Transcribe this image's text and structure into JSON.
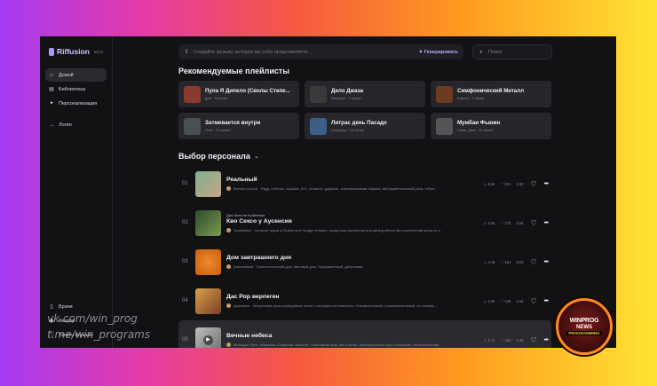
{
  "brand": {
    "name": "Riffusion",
    "beta": "BETA",
    "color": "#a896ff"
  },
  "sidebar": {
    "items": [
      {
        "label": "Домой",
        "icon": "home-icon",
        "active": true
      },
      {
        "label": "Библиотека",
        "icon": "library-icon"
      },
      {
        "label": "Персонализация",
        "icon": "personalize-icon"
      },
      {
        "label": "Логин",
        "icon": "login-icon"
      }
    ],
    "bottom": [
      {
        "label": "Врачи",
        "icon": "doc-icon"
      },
      {
        "label": "Раздор",
        "icon": "discord-icon"
      },
      {
        "label": "Узнать больше",
        "icon": "info-icon"
      }
    ]
  },
  "topbar": {
    "prompt_placeholder": "Создайте музыку, которую вы себе представляете...",
    "generate_label": "Генерировать",
    "search_placeholder": "Поиск"
  },
  "playlists_section": {
    "title": "Рекомендуемые плейлисты",
    "items": [
      {
        "title": "Пупа Я Дипело (Сволы Степе...",
        "meta": "дом · 9 песен",
        "color": "#8a3a2e"
      },
      {
        "title": "Дело Джаза",
        "meta": "Maverick · 7 песен",
        "color": "#3a3a3a"
      },
      {
        "title": "Симфонический Металл",
        "meta": "Katona · 7 песен",
        "color": "#6b3b22"
      },
      {
        "title": "Затмевается внутри",
        "meta": "Orbit · 10 песен",
        "color": "#4a4f55"
      },
      {
        "title": "Литрас день Пасадо",
        "meta": "Ceramica · 10 песен",
        "color": "#3b5f86"
      },
      {
        "title": "Мумбаи Фьюжн",
        "meta": "Cyber_bam · 11 песен",
        "color": "#555555"
      }
    ]
  },
  "picks_section": {
    "title": "Выбор персонала",
    "tracks": [
      {
        "num": "01",
        "label": "",
        "title": "Реальный",
        "desc": "Фонтан голоса · Рэдд, хтбилос, поршни, ATL, Атланта, ударные, альтернативная поршни, инструментальный ритм, хтбил...",
        "plays": "9.8к",
        "likes": "221",
        "duration": "2:40",
        "cover": "#6f8a7a"
      },
      {
        "num": "02",
        "label": "Que Sexo en la America",
        "title": "Кво Сексо у Аусенсия",
        "desc": "Транеёжно · Immerse signal of Dublin and Yongjin remarks, using basic waveforms and adding effects like experimental decay to s...",
        "plays": "3.9к",
        "likes": "175",
        "duration": "3:25",
        "cover": "#3f5f3a"
      },
      {
        "num": "03",
        "label": "",
        "title": "Дом завтрашнего дня",
        "desc": "Алексейвиа · Технологический дом, Миговый дом, Неукрашенный, дихотомии",
        "plays": "4.3к",
        "likes": "161",
        "duration": "2:53",
        "cover": "#d9781e"
      },
      {
        "num": "04",
        "label": "",
        "title": "Дас Рор верпеген",
        "desc": "Дорокиин · Энергичная фолк-комедийная песня с игрищем сентиментал, Оптимистичный и развлекательный, по словам,...",
        "plays": "3.9к",
        "likes": "129",
        "duration": "2:44",
        "cover": "#b87a3a"
      },
      {
        "num": "05",
        "label": "",
        "title": "Вечные небеса",
        "desc": "Молодая Петя · Мировая, Странная, эмбиент, Позитивная мир, Фи-Н ритм, Электрическая гора, Колебание, Нёгалебальная...",
        "plays": "2.7к",
        "likes": "152",
        "duration": "2:45",
        "cover": "#9a9a9a"
      }
    ]
  },
  "watermark": {
    "line1": "vk.com/win_prog",
    "line2": "t.me/win_programs"
  },
  "badge": {
    "line1": "WINPROG",
    "line2": "NEWS",
    "line3": "PROGRAMMING"
  }
}
